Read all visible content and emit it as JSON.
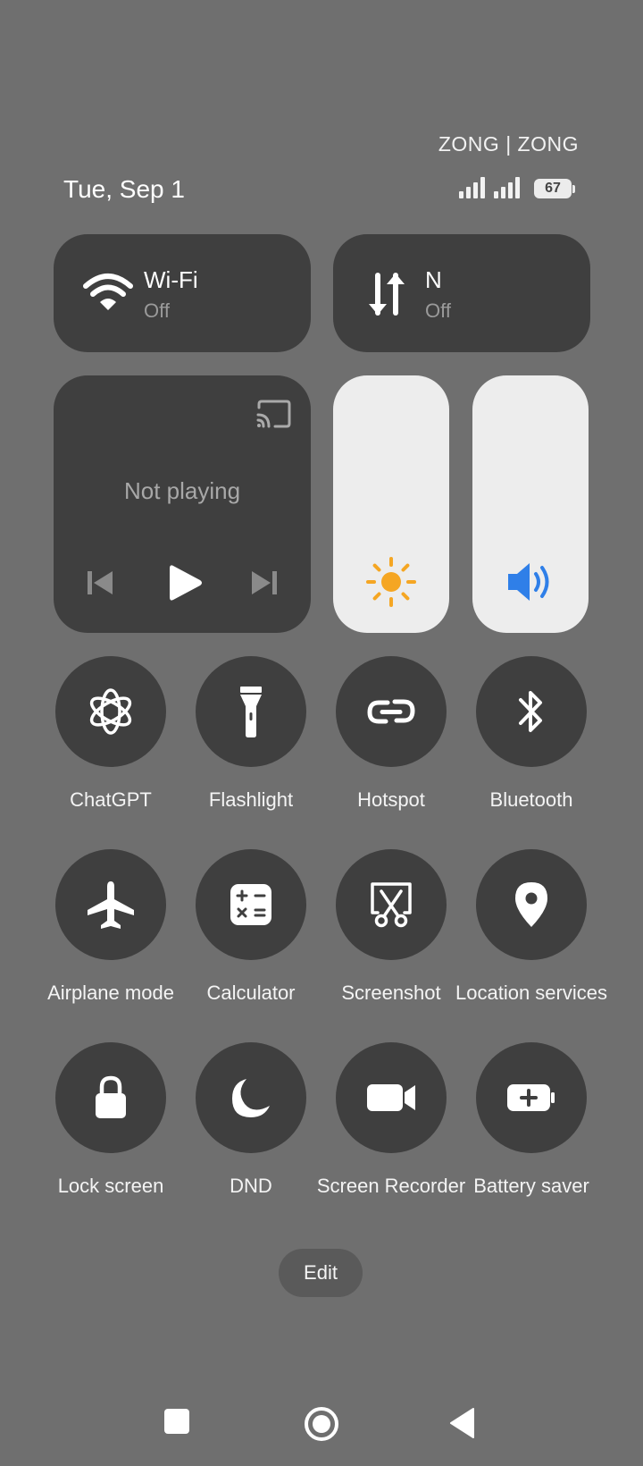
{
  "status_bar": {
    "carrier": "ZONG | ZONG",
    "date": "Tue, Sep 1",
    "battery": "67"
  },
  "tiles": {
    "wifi": {
      "title": "Wi-Fi",
      "state": "Off"
    },
    "data": {
      "title": "N",
      "state": "Off"
    }
  },
  "media": {
    "status": "Not playing"
  },
  "sliders": {
    "brightness_color": "#f5a623",
    "volume_color": "#2f7fe8"
  },
  "quick_settings": [
    {
      "label": "ChatGPT",
      "icon": "chatgpt-icon"
    },
    {
      "label": "Flashlight",
      "icon": "flashlight-icon"
    },
    {
      "label": "Hotspot",
      "icon": "hotspot-icon"
    },
    {
      "label": "Bluetooth",
      "icon": "bluetooth-icon"
    },
    {
      "label": "Airplane mode",
      "icon": "airplane-icon"
    },
    {
      "label": "Calculator",
      "icon": "calculator-icon"
    },
    {
      "label": "Screenshot",
      "icon": "screenshot-icon"
    },
    {
      "label": "Location services",
      "icon": "location-icon"
    },
    {
      "label": "Lock screen",
      "icon": "lock-icon"
    },
    {
      "label": "DND",
      "icon": "moon-icon"
    },
    {
      "label": "Screen Recorder",
      "icon": "video-camera-icon"
    },
    {
      "label": "Battery saver",
      "icon": "battery-saver-icon"
    }
  ],
  "edit_label": "Edit",
  "navigation": [
    "recents-icon",
    "home-icon",
    "back-icon"
  ]
}
